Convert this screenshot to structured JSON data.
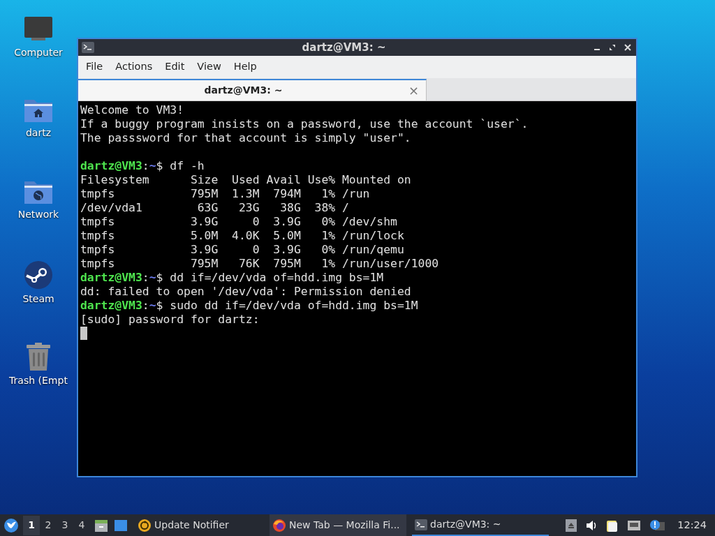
{
  "desktop_icons": [
    {
      "kind": "computer",
      "label": "Computer"
    },
    {
      "kind": "home",
      "label": "dartz"
    },
    {
      "kind": "network",
      "label": "Network"
    },
    {
      "kind": "steam",
      "label": "Steam"
    },
    {
      "kind": "trash",
      "label": "Trash (Empt"
    }
  ],
  "window": {
    "title": "dartz@VM3: ~"
  },
  "menu": [
    "File",
    "Actions",
    "Edit",
    "View",
    "Help"
  ],
  "tabs": [
    {
      "label": "dartz@VM3: ~",
      "selected": true,
      "close": "×"
    }
  ],
  "terminal": {
    "lines": [
      {
        "kind": "output",
        "text": "Welcome to VM3!"
      },
      {
        "kind": "output",
        "text": "If a buggy program insists on a password, use the account `user`."
      },
      {
        "kind": "output",
        "text": "The passsword for that account is simply \"user\"."
      },
      {
        "kind": "blank"
      },
      {
        "kind": "prompt",
        "host": "dartz@VM3",
        "colon": ":",
        "cwd": "~",
        "sign": "$",
        "command": " df -h"
      },
      {
        "kind": "output",
        "text": "Filesystem      Size  Used Avail Use% Mounted on"
      },
      {
        "kind": "output",
        "text": "tmpfs           795M  1.3M  794M   1% /run"
      },
      {
        "kind": "output",
        "text": "/dev/vda1        63G   23G   38G  38% /"
      },
      {
        "kind": "output",
        "text": "tmpfs           3.9G     0  3.9G   0% /dev/shm"
      },
      {
        "kind": "output",
        "text": "tmpfs           5.0M  4.0K  5.0M   1% /run/lock"
      },
      {
        "kind": "output",
        "text": "tmpfs           3.9G     0  3.9G   0% /run/qemu"
      },
      {
        "kind": "output",
        "text": "tmpfs           795M   76K  795M   1% /run/user/1000"
      },
      {
        "kind": "prompt",
        "host": "dartz@VM3",
        "colon": ":",
        "cwd": "~",
        "sign": "$",
        "command": " dd if=/dev/vda of=hdd.img bs=1M"
      },
      {
        "kind": "output",
        "text": "dd: failed to open '/dev/vda': Permission denied"
      },
      {
        "kind": "prompt",
        "host": "dartz@VM3",
        "colon": ":",
        "cwd": "~",
        "sign": "$",
        "command": " sudo dd if=/dev/vda of=hdd.img bs=1M"
      },
      {
        "kind": "output",
        "text": "[sudo] password for dartz:"
      },
      {
        "kind": "cursor"
      }
    ]
  },
  "taskbar": {
    "workspaces": [
      {
        "label": "1",
        "selected": true
      },
      {
        "label": "2",
        "selected": false
      },
      {
        "label": "3",
        "selected": false
      },
      {
        "label": "4",
        "selected": false
      }
    ],
    "tasks": [
      {
        "kind": "updater",
        "label": "Update Notifier",
        "selected": false
      },
      {
        "kind": "firefox",
        "label": "New Tab — Mozilla Fi...",
        "selected": false
      },
      {
        "kind": "terminal",
        "label": "dartz@VM3: ~",
        "selected": true
      }
    ],
    "clock": "12:24"
  }
}
